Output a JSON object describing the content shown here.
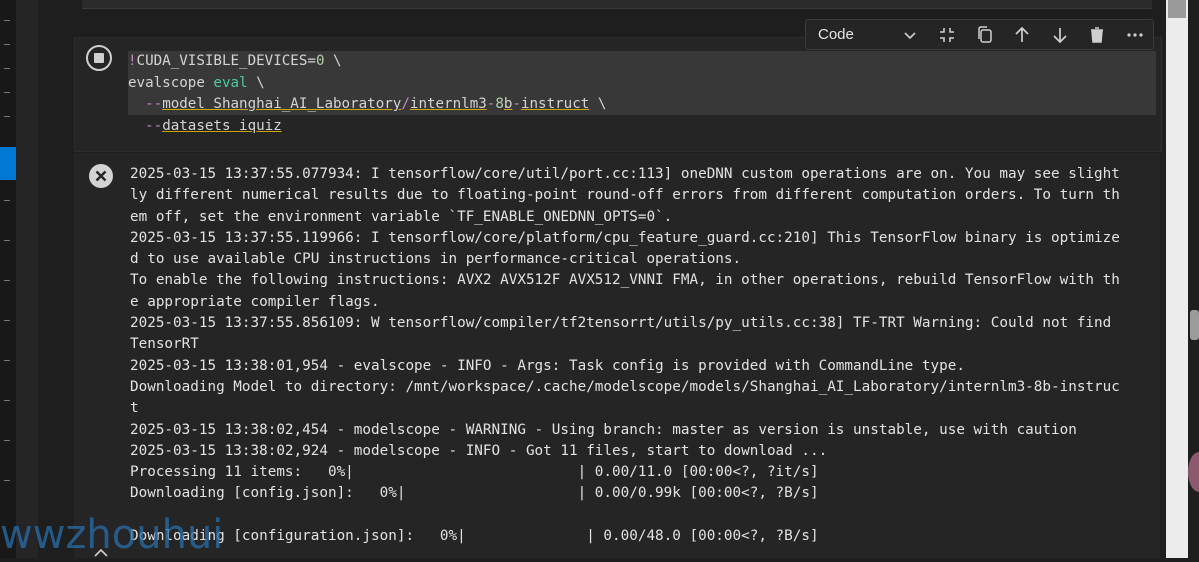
{
  "toolbar": {
    "language": "Code",
    "icons": [
      "chevron-down-icon",
      "collapse-icon",
      "copy-icon",
      "move-up-icon",
      "move-down-icon",
      "delete-icon",
      "more-icon"
    ]
  },
  "code_cell": {
    "lines": [
      {
        "segments": [
          {
            "t": "!",
            "c": "bang"
          },
          {
            "t": "CUDA_VISIBLE_DEVICES",
            "c": "env"
          },
          {
            "t": "=",
            "c": "eq"
          },
          {
            "t": "0",
            "c": "num"
          },
          {
            "t": " \\",
            "c": "cont"
          }
        ]
      },
      {
        "segments": [
          {
            "t": "evalscope ",
            "c": "env"
          },
          {
            "t": "eval",
            "c": "kw"
          },
          {
            "t": " \\",
            "c": "cont"
          }
        ]
      },
      {
        "segments": [
          {
            "t": "  ",
            "c": "cont"
          },
          {
            "t": "--",
            "c": "dash"
          },
          {
            "t": "model Shanghai_AI_Laboratory",
            "c": "arg"
          },
          {
            "t": "/",
            "c": "dash"
          },
          {
            "t": "internlm3",
            "c": "arg"
          },
          {
            "t": "-",
            "c": "dash"
          },
          {
            "t": "8",
            "c": "num"
          },
          {
            "t": "b",
            "c": "arg"
          },
          {
            "t": "-",
            "c": "dash"
          },
          {
            "t": "instruct",
            "c": "arg"
          },
          {
            "t": " \\",
            "c": "cont"
          }
        ]
      },
      {
        "segments": [
          {
            "t": "  ",
            "c": "cont"
          },
          {
            "t": "--",
            "c": "dash"
          },
          {
            "t": "datasets iquiz",
            "c": "arg"
          }
        ]
      }
    ]
  },
  "output": {
    "lines": [
      "2025-03-15 13:37:55.077934: I tensorflow/core/util/port.cc:113] oneDNN custom operations are on. You may see slight",
      "ly different numerical results due to floating-point round-off errors from different computation orders. To turn th",
      "em off, set the environment variable `TF_ENABLE_ONEDNN_OPTS=0`.",
      "2025-03-15 13:37:55.119966: I tensorflow/core/platform/cpu_feature_guard.cc:210] This TensorFlow binary is optimize",
      "d to use available CPU instructions in performance-critical operations.",
      "To enable the following instructions: AVX2 AVX512F AVX512_VNNI FMA, in other operations, rebuild TensorFlow with th",
      "e appropriate compiler flags.",
      "2025-03-15 13:37:55.856109: W tensorflow/compiler/tf2tensorrt/utils/py_utils.cc:38] TF-TRT Warning: Could not find",
      "TensorRT",
      "2025-03-15 13:38:01,954 - evalscope - INFO - Args: Task config is provided with CommandLine type.",
      "Downloading Model to directory: /mnt/workspace/.cache/modelscope/models/Shanghai_AI_Laboratory/internlm3-8b-instruc",
      "t",
      "2025-03-15 13:38:02,454 - modelscope - WARNING - Using branch: master as version is unstable, use with caution",
      "2025-03-15 13:38:02,924 - modelscope - INFO - Got 11 files, start to download ...",
      "Processing 11 items:   0%|                          | 0.00/11.0 [00:00<?, ?it/s]",
      "Downloading [config.json]:   0%|                    | 0.00/0.99k [00:00<?, ?B/s]",
      "",
      "Downloading [configuration.json]:   0%|              | 0.00/48.0 [00:00<?, ?B/s]"
    ]
  },
  "watermark": "wwzhouhui"
}
